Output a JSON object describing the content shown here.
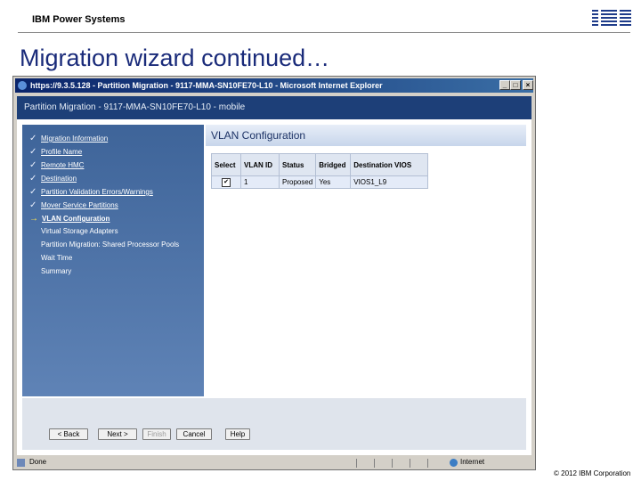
{
  "slide": {
    "brand": "IBM Power Systems",
    "title": "Migration wizard continued…",
    "copyright": "© 2012 IBM Corporation"
  },
  "browser": {
    "title": "https://9.3.5.128 - Partition Migration - 9117-MMA-SN10FE70-L10 - Microsoft Internet Explorer",
    "status_text": "Done",
    "zone_text": "Internet",
    "min_btn": "_",
    "max_btn": "□",
    "close_btn": "×"
  },
  "page": {
    "header": "Partition Migration - 9117-MMA-SN10FE70-L10 - mobile",
    "nav": [
      {
        "label": "Migration Information",
        "state": "done"
      },
      {
        "label": "Profile Name",
        "state": "done"
      },
      {
        "label": "Remote HMC",
        "state": "done"
      },
      {
        "label": "Destination",
        "state": "done"
      },
      {
        "label": "Partition Validation Errors/Warnings",
        "state": "done"
      },
      {
        "label": "Mover Service Partitions",
        "state": "done"
      },
      {
        "label": "VLAN Configuration",
        "state": "current"
      },
      {
        "label": "Virtual Storage Adapters",
        "state": "todo"
      },
      {
        "label": "Partition Migration: Shared Processor Pools",
        "state": "todo"
      },
      {
        "label": "Wait Time",
        "state": "todo"
      },
      {
        "label": "Summary",
        "state": "todo"
      }
    ],
    "content_title": "VLAN Configuration",
    "table": {
      "headers": [
        "Select",
        "VLAN ID",
        "Status",
        "Bridged",
        "Destination VIOS"
      ],
      "rows": [
        {
          "select": true,
          "vlan_id": "1",
          "status": "Proposed",
          "bridged": "Yes",
          "destination_vios": "VIOS1_L9"
        }
      ]
    },
    "buttons": {
      "back": "< Back",
      "next": "Next >",
      "finish": "Finish",
      "cancel": "Cancel",
      "help": "Help"
    }
  },
  "colors": {
    "slide_title": "#1a2b7a",
    "page_header": "#1d3f78",
    "sidebar": "#4a6fa5",
    "titlebar": "#0a246a"
  },
  "icons": {
    "check": "✓",
    "arrow": "→",
    "checkbox_mark": "✔"
  }
}
